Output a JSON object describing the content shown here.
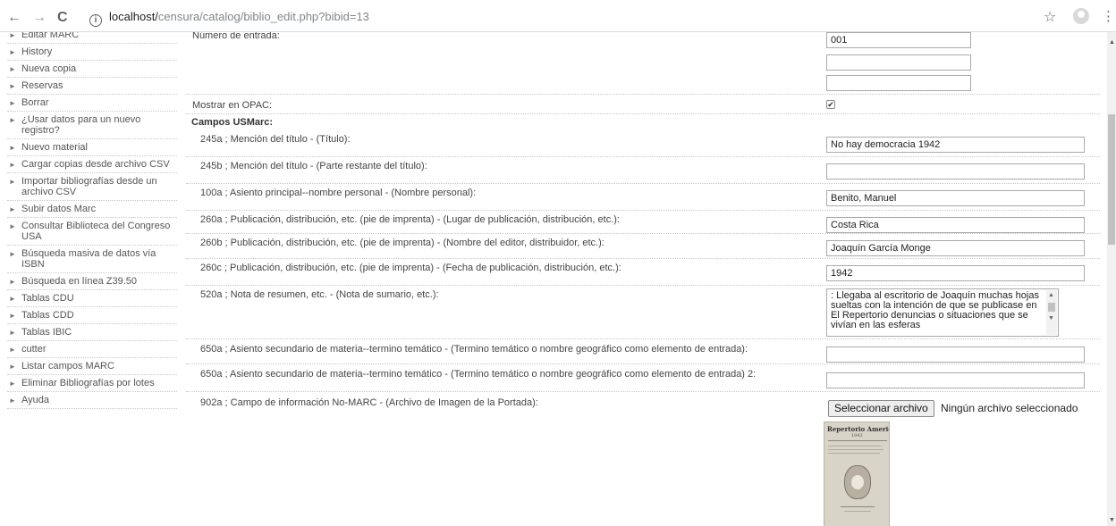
{
  "browser": {
    "back": "←",
    "forward": "→",
    "reload": "C",
    "url_host": "localhost/",
    "url_path": "censura/catalog/biblio_edit.php?bibid=13",
    "star": "☆",
    "menu": "⋮"
  },
  "sidebar": {
    "items": [
      {
        "label": "Editar MARC"
      },
      {
        "label": "History"
      },
      {
        "label": "Nueva copia"
      },
      {
        "label": "Reservas"
      },
      {
        "label": "Borrar"
      },
      {
        "label": "¿Usar datos para un nuevo registro?"
      },
      {
        "label": "Nuevo material"
      },
      {
        "label": "Cargar copias desde archivo CSV"
      },
      {
        "label": "Importar bibliografías desde un archivo CSV"
      },
      {
        "label": "Subir datos Marc"
      },
      {
        "label": "Consultar Biblioteca del Congreso USA"
      },
      {
        "label": "Búsqueda masiva de datos vía ISBN"
      },
      {
        "label": "Búsqueda en línea Z39.50"
      },
      {
        "label": "Tablas CDU"
      },
      {
        "label": "Tablas CDD"
      },
      {
        "label": "Tablas IBIC"
      },
      {
        "label": "cutter"
      },
      {
        "label": "Listar campos MARC"
      },
      {
        "label": "Eliminar Bibliografías por lotes"
      },
      {
        "label": "Ayuda"
      }
    ]
  },
  "form": {
    "entry_number_label": "Número de entrada:",
    "entry_number_values": [
      "001",
      "",
      ""
    ],
    "opac_label": "Mostrar en OPAC:",
    "opac_checked": true,
    "opac_check_glyph": "✔",
    "section_title": "Campos USMarc:",
    "fields": [
      {
        "label": "245a ; Mención del título - (Título):",
        "value": "No hay democracia 1942"
      },
      {
        "label": "245b ; Mención del título - (Parte restante del título):",
        "value": ""
      },
      {
        "label": "100a ; Asiento principal--nombre personal - (Nombre personal):",
        "value": "Benito, Manuel"
      },
      {
        "label": "260a ; Publicación, distribución, etc. (pie de imprenta) - (Lugar de publicación, distribución, etc.):",
        "value": "Costa Rica"
      },
      {
        "label": "260b ; Publicación, distribución, etc. (pie de imprenta) - (Nombre del editor, distribuidor, etc.):",
        "value": "Joaquín García Monge"
      },
      {
        "label": "260c ; Publicación, distribución, etc. (pie de imprenta) - (Fecha de publicación, distribución, etc.):",
        "value": "1942"
      }
    ],
    "summary": {
      "label": "520a ; Nota de resumen, etc. - (Nota de sumario, etc.):",
      "value": ": Llegaba al escritorio de Joaquín muchas hojas sueltas con la intención de que se publicase en El Repertorio denuncias o situaciones que se vivían en las esferas"
    },
    "subject_fields": [
      {
        "label": "650a ; Asiento secundario de materia--termino temático - (Termino temático o nombre geográfico como elemento de entrada):",
        "value": ""
      },
      {
        "label": "650a ; Asiento secundario de materia--termino temático - (Termino temático o nombre geográfico como elemento de entrada) 2:",
        "value": ""
      }
    ],
    "cover": {
      "label": "902a ; Campo de información No-MARC - (Archivo de Imagen de la Portada):",
      "button": "Seleccionar archivo",
      "no_file": "Ningún archivo seleccionado",
      "image_title": "Repertorio Americano",
      "image_year": "1942"
    }
  }
}
